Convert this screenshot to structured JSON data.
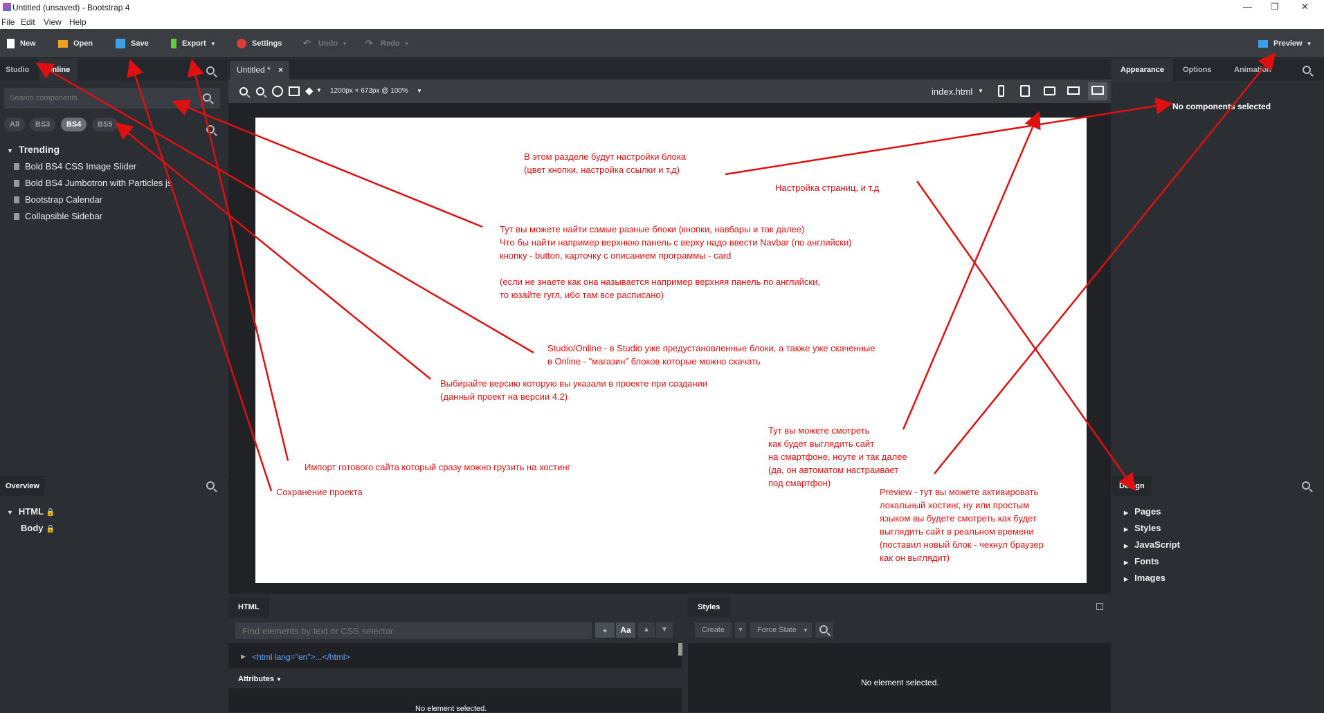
{
  "window": {
    "title": "Untitled (unsaved) - Bootstrap 4",
    "controls": [
      "—",
      "❐",
      "✕"
    ]
  },
  "menu": [
    "File",
    "Edit",
    "View",
    "Help"
  ],
  "toolbar": {
    "new": "New",
    "open": "Open",
    "save": "Save",
    "export": "Export",
    "settings": "Settings",
    "undo": "Undo",
    "redo": "Redo",
    "preview": "Preview"
  },
  "left": {
    "tabs": [
      "Studio",
      "Online"
    ],
    "search_placeholder": "Search components",
    "versions": [
      "All",
      "BS3",
      "BS4",
      "BS5"
    ],
    "trending_label": "Trending",
    "trending": [
      "Bold BS4 CSS Image Slider",
      "Bold BS4 Jumbotron with Particles js",
      "Bootstrap Calendar",
      "Collapsible Sidebar"
    ],
    "overview_label": "Overview",
    "overview": [
      "HTML",
      "Body"
    ]
  },
  "center": {
    "doc_tab": "Untitled *",
    "doc_close": "×",
    "viewport": "1200px × 673px @ 100%",
    "page_select": "index.html"
  },
  "right": {
    "tabs": [
      "Appearance",
      "Options",
      "Animation"
    ],
    "no_selection": "No components selected",
    "design_label": "Design",
    "design_items": [
      "Pages",
      "Styles",
      "JavaScript",
      "Fonts",
      "Images"
    ]
  },
  "bottom": {
    "html_label": "HTML",
    "find_placeholder": "Find elements by text or CSS selector",
    "case_label": "Aa",
    "code_line": "<html lang=\"en\">...</html>",
    "attributes_label": "Attributes",
    "attributes_empty": "No element selected.",
    "styles_label": "Styles",
    "create_label": "Create",
    "force_state_label": "Force State",
    "styles_empty": "No element selected."
  },
  "annotations": {
    "block_settings": "В этом разделе будут настройки блока\n(цвет кнопки, настройка ссылки и т.д)",
    "page_settings": "Настройка страниц, и т.д",
    "search_help": "Тут вы можете найти самые разные блоки (кнопки, навбары и так далее)\nЧто бы найти например верхнюю панель с верху надо ввести Navbar (по английски)\nкнопку - button, карточку с описанием программы - card\n\n(если не знаете как она называется например верхняя панель по английски,\nто юзайте гугл, ибо там все расписано)",
    "studio_online": "Studio/Online - в Studio уже предустановленные блоки, а также уже скаченные\nв Online - \"магазин\" блоков которые можно скачать",
    "version": "Выбирайте версию которую вы указали в проекте при создании\n(данный проект на версии 4.2)",
    "devices": "Тут вы можете смотреть\nкак будет выглядить сайт\nна смартфоне, ноуте и так далее\n(да, он автоматом настраивает\nпод смартфон)",
    "export": "Импорт готового сайта который сразу можно грузить на хостинг",
    "save": "Сохранение проекта",
    "preview": "Preview - тут вы можете активировать\nлокальный хостинг, ну или простым\nязыком вы будете смотреть как будет\nвыглядить сайт в реальном времени\n(поставил новый блок - чекнул браузер\nкак он выглядит)"
  },
  "colors": {
    "annotation": "#e01010",
    "accent_online": "#ffffff"
  }
}
